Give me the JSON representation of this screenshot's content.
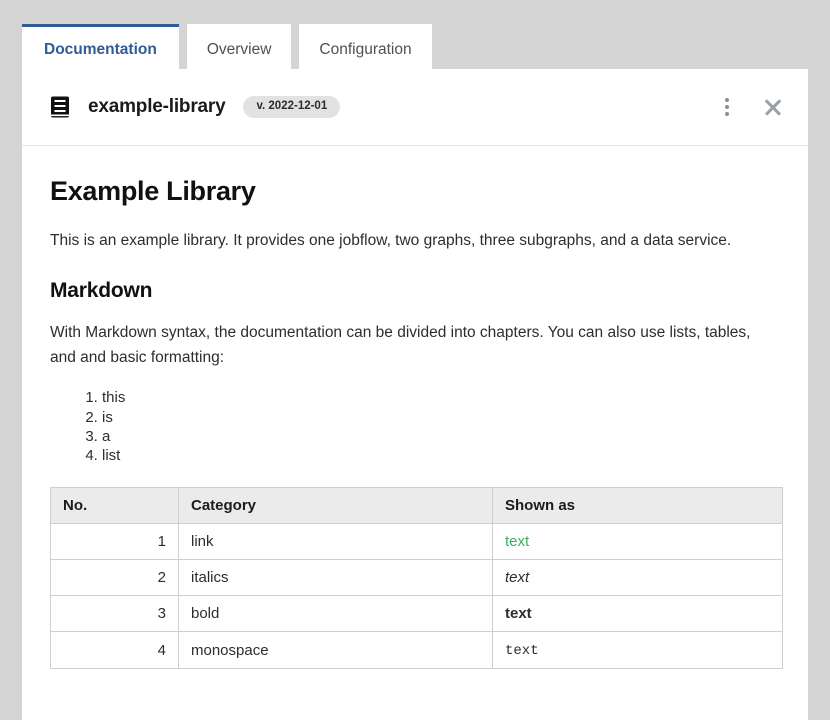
{
  "tabs": [
    {
      "label": "Documentation",
      "active": true
    },
    {
      "label": "Overview",
      "active": false
    },
    {
      "label": "Configuration",
      "active": false
    }
  ],
  "header": {
    "icon": "book-icon",
    "title": "example-library",
    "version_badge": "v. 2022-12-01",
    "menu_icon": "kebab-menu-icon",
    "close_icon": "close-icon"
  },
  "content": {
    "title": "Example Library",
    "intro": "This is an example library. It provides one jobflow, two graphs, three subgraphs, and a data service.",
    "section_title": "Markdown",
    "section_para": "With Markdown syntax, the documentation can be divided into chapters. You can also use lists, tables, and and basic formatting:",
    "list_items": [
      "this",
      "is",
      "a",
      "list"
    ],
    "table": {
      "columns": [
        "No.",
        "Category",
        "Shown as"
      ],
      "rows": [
        {
          "no": "1",
          "category": "link",
          "shown": "text",
          "style": "link"
        },
        {
          "no": "2",
          "category": "italics",
          "shown": "text",
          "style": "italic"
        },
        {
          "no": "3",
          "category": "bold",
          "shown": "text",
          "style": "bold"
        },
        {
          "no": "4",
          "category": "monospace",
          "shown": "text",
          "style": "mono"
        }
      ]
    }
  },
  "colors": {
    "page_background": "#d4d4d4",
    "accent_blue": "#2f5b96",
    "link_green": "#3fae63",
    "badge_background": "#e2e2e2",
    "table_header_background": "#ebebeb"
  }
}
